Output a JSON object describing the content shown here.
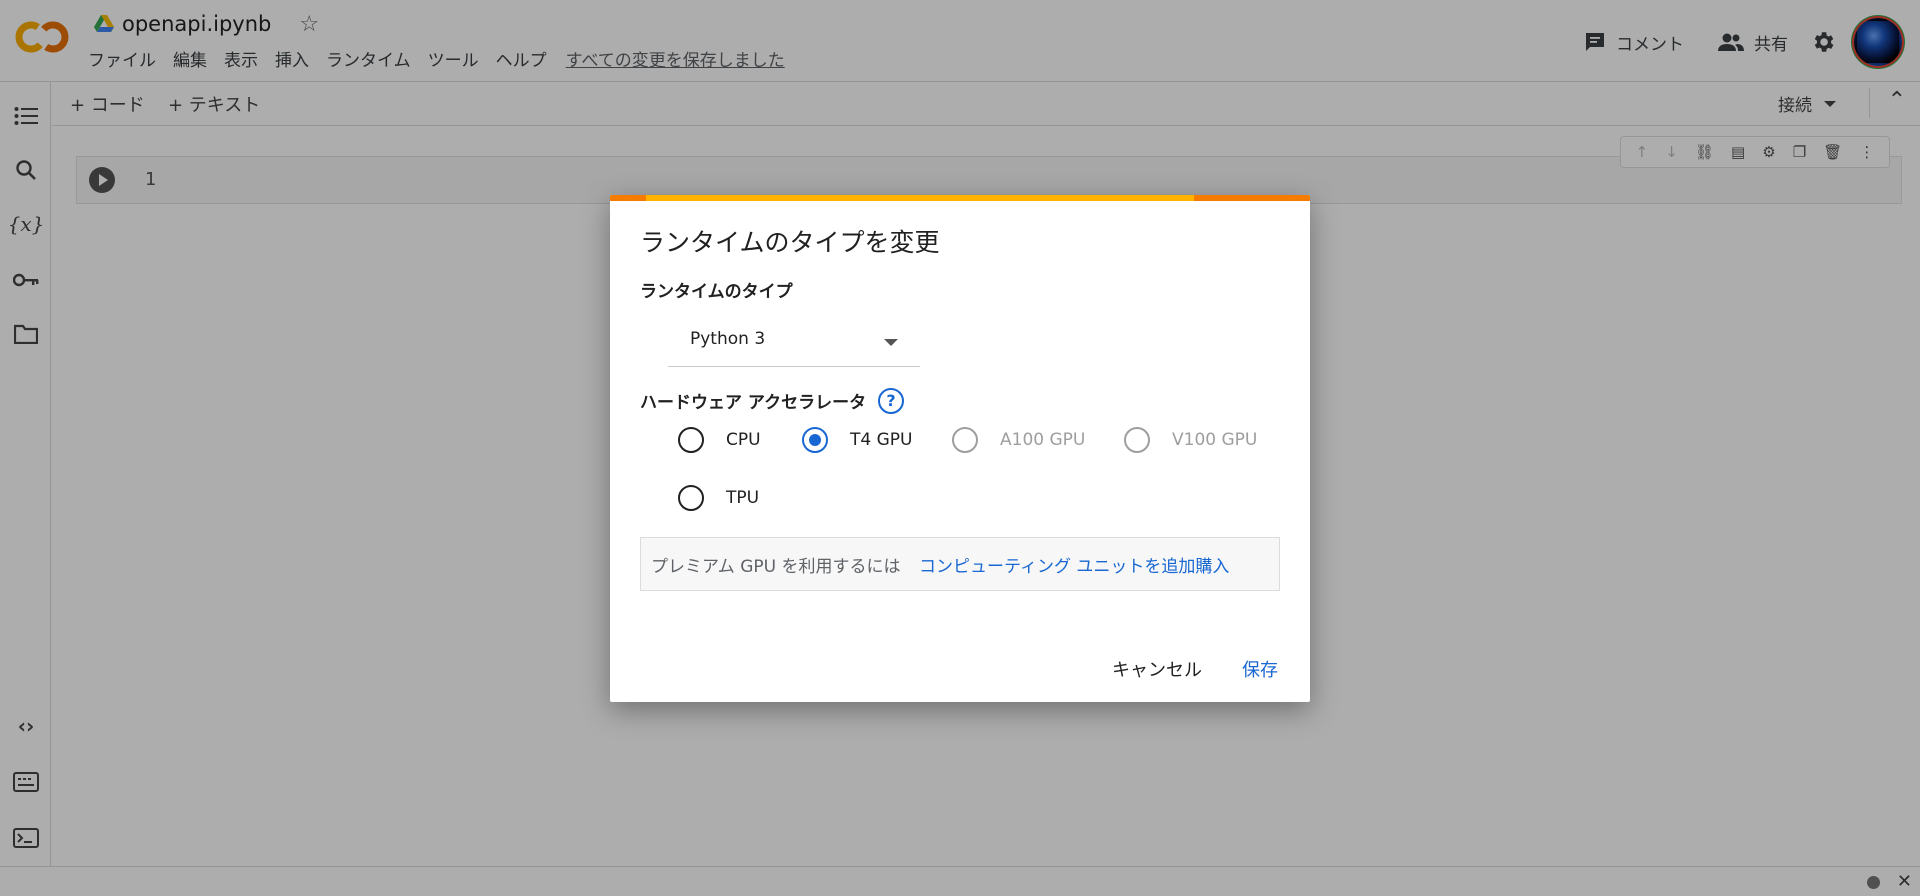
{
  "header": {
    "filename": "openapi.ipynb",
    "menu": [
      "ファイル",
      "編集",
      "表示",
      "挿入",
      "ランタイム",
      "ツール",
      "ヘルプ"
    ],
    "saved_status": "すべての変更を保存しました",
    "comment_label": "コメント",
    "share_label": "共有"
  },
  "toolbar": {
    "add_code": "+ コード",
    "add_text": "+ テキスト",
    "connect_label": "接続"
  },
  "cell": {
    "line_number": "1"
  },
  "dialog": {
    "title": "ランタイムのタイプを変更",
    "runtime_type_label": "ランタイムのタイプ",
    "runtime_type_value": "Python 3",
    "accelerator_label": "ハードウェア アクセラレータ",
    "help_glyph": "?",
    "options": [
      {
        "label": "CPU",
        "state": "unchecked"
      },
      {
        "label": "T4 GPU",
        "state": "checked"
      },
      {
        "label": "A100 GPU",
        "state": "disabled"
      },
      {
        "label": "V100 GPU",
        "state": "disabled"
      },
      {
        "label": "TPU",
        "state": "unchecked"
      }
    ],
    "premium_text": "プレミアム GPU を利用するには",
    "premium_link": "コンピューティング ユニットを追加購入",
    "cancel_label": "キャンセル",
    "save_label": "保存"
  },
  "colors": {
    "accent": "#1967d2",
    "bar_orange": "#f57c00",
    "bar_yellow": "#ffb300"
  }
}
